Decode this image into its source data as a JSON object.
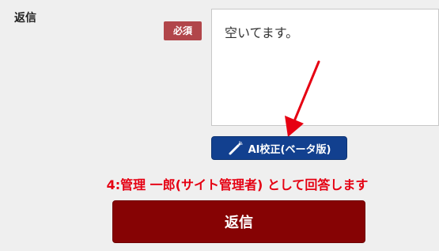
{
  "form": {
    "field_label": "返信",
    "required_badge": "必須",
    "textarea_value": "空いてます。"
  },
  "ai_button": {
    "label": "AI校正(ベータ版)",
    "icon": "magic-wand-icon"
  },
  "answer_note": "4:管理 一郎(サイト管理者) として回答します",
  "submit_button": {
    "label": "返信"
  },
  "colors": {
    "background": "#efefef",
    "required_badge": "#b1464a",
    "ai_button": "#12408f",
    "note_text": "#e50012",
    "submit_button": "#860304",
    "arrow": "#e60012"
  }
}
